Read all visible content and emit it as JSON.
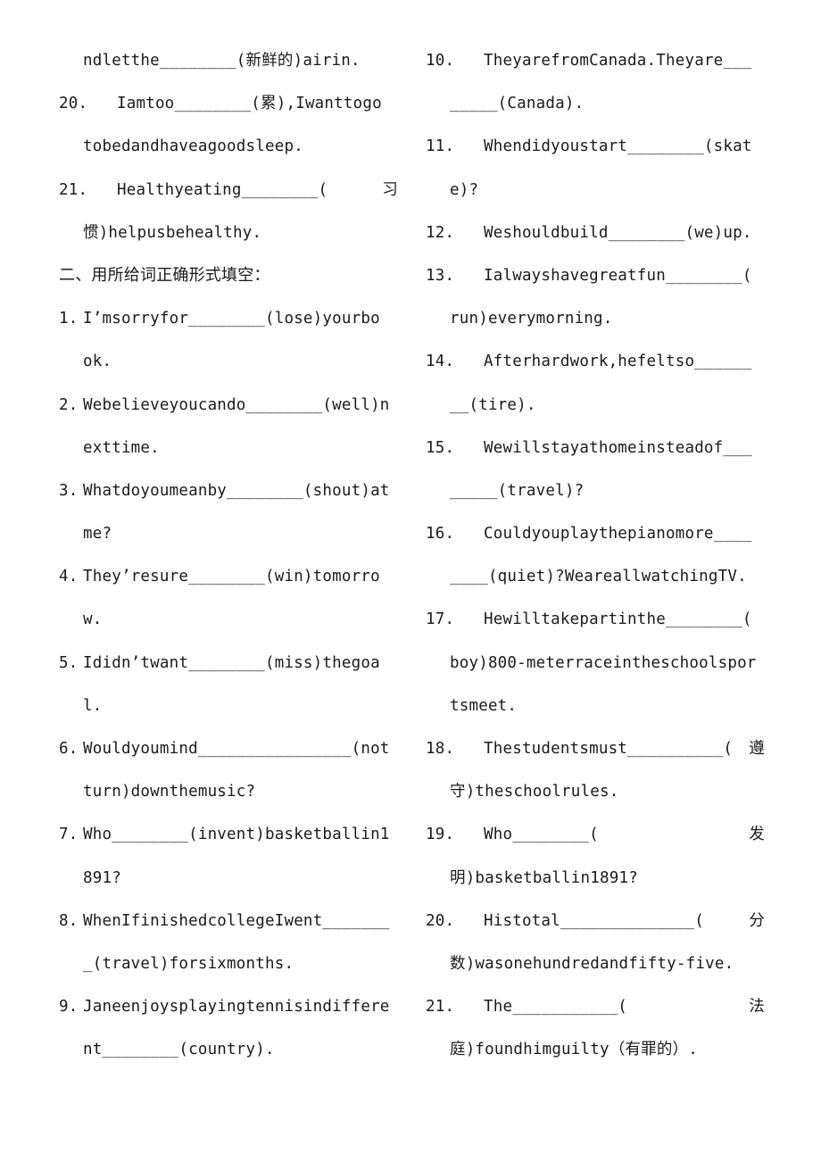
{
  "document": {
    "left_column": {
      "lines": [
        {
          "type": "cont",
          "text": "ndletthe________(新鲜的)airin."
        },
        {
          "type": "item",
          "num": "20.",
          "num_style": "wide",
          "text": "Iamtoo________(累),Iwanttogo"
        },
        {
          "type": "cont",
          "text": "tobedandhaveagoodsleep."
        },
        {
          "type": "item-justify",
          "num": "21.",
          "num_style": "wide",
          "text": "Healthyeating________(",
          "tail": "习"
        },
        {
          "type": "cont",
          "text": "惯)helpusbehealthy."
        },
        {
          "type": "heading",
          "text": "二、用所给词正确形式填空："
        },
        {
          "type": "item",
          "num": "1.",
          "num_style": "narrow",
          "text": "I’msorryfor________(lose)yourbo"
        },
        {
          "type": "cont",
          "text": "ok."
        },
        {
          "type": "item",
          "num": "2.",
          "num_style": "narrow",
          "text": "Webelieveyoucando________(well)n"
        },
        {
          "type": "cont",
          "text": "exttime."
        },
        {
          "type": "item",
          "num": "3.",
          "num_style": "narrow",
          "text": "Whatdoyoumeanby________(shout)at"
        },
        {
          "type": "cont",
          "text": "me?"
        },
        {
          "type": "item",
          "num": "4.",
          "num_style": "narrow",
          "text": "They’resure________(win)tomorro"
        },
        {
          "type": "cont",
          "text": "w."
        },
        {
          "type": "item",
          "num": "5.",
          "num_style": "narrow",
          "text": "Ididn’twant________(miss)thegoa"
        },
        {
          "type": "cont",
          "text": "l."
        },
        {
          "type": "item",
          "num": "6.",
          "num_style": "narrow",
          "text": "Wouldyoumind________________(not"
        },
        {
          "type": "cont",
          "text": "turn)downthemusic?"
        },
        {
          "type": "item",
          "num": "7.",
          "num_style": "narrow",
          "text": "Who________(invent)basketballin1"
        },
        {
          "type": "cont",
          "text": "891?"
        },
        {
          "type": "item",
          "num": "8.",
          "num_style": "narrow",
          "text": "WhenIfinishedcollegeIwent_______"
        },
        {
          "type": "cont",
          "text": "_(travel)forsixmonths."
        },
        {
          "type": "item",
          "num": "9.",
          "num_style": "narrow",
          "text": "Janeenjoysplayingtennisindiffere"
        },
        {
          "type": "cont",
          "text": "nt________(country)."
        }
      ]
    },
    "right_column": {
      "lines": [
        {
          "type": "item",
          "num": "10.",
          "text": "TheyarefromCanada.Theyare___"
        },
        {
          "type": "cont",
          "text": "_____(Canada)."
        },
        {
          "type": "item",
          "num": "11.",
          "text": "Whendidyoustart________(skat"
        },
        {
          "type": "cont",
          "text": "e)?"
        },
        {
          "type": "item",
          "num": "12.",
          "text": "Weshouldbuild________(we)up."
        },
        {
          "type": "item",
          "num": "13.",
          "text": "Ialwayshavegreatfun________("
        },
        {
          "type": "cont",
          "text": "run)everymorning."
        },
        {
          "type": "item",
          "num": "14.",
          "text": "Afterhardwork,hefeltso______"
        },
        {
          "type": "cont",
          "text": "__(tire)."
        },
        {
          "type": "item",
          "num": "15.",
          "text": "Wewillstayathomeinsteadof___"
        },
        {
          "type": "cont",
          "text": "_____(travel)?"
        },
        {
          "type": "item",
          "num": "16.",
          "text": "Couldyouplaythepianomore____"
        },
        {
          "type": "cont",
          "text": "____(quiet)?WeareallwatchingTV."
        },
        {
          "type": "item",
          "num": "17.",
          "text": "Hewilltakepartinthe________("
        },
        {
          "type": "cont",
          "text": "boy)800-meterraceintheschoolspor"
        },
        {
          "type": "cont",
          "text": "tsmeet."
        },
        {
          "type": "item-justify",
          "num": "18.",
          "text": "Thestudentsmust__________(",
          "tail": "遵"
        },
        {
          "type": "cont",
          "text": "守)theschoolrules."
        },
        {
          "type": "item-justify",
          "num": "19.",
          "text": "Who________(",
          "tail": "发"
        },
        {
          "type": "cont",
          "text": "明)basketballin1891?"
        },
        {
          "type": "item-justify",
          "num": "20.",
          "text": "Histotal______________(",
          "tail": "分"
        },
        {
          "type": "cont",
          "text": "数)wasonehundredandfifty-five."
        },
        {
          "type": "item-justify",
          "num": "21.",
          "text": "The___________(",
          "tail": "法"
        },
        {
          "type": "cont",
          "text": "庭)foundhimguilty（有罪的）."
        }
      ]
    }
  }
}
